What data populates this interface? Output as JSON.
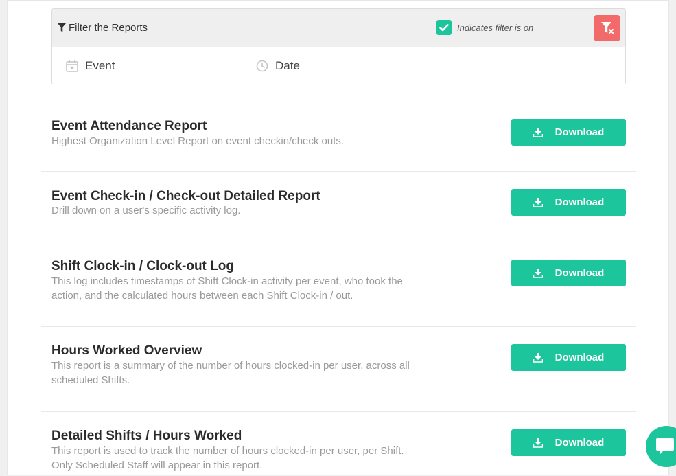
{
  "filter": {
    "title": "Filter the Reports",
    "indicator_text": "Indicates filter is on",
    "options": [
      {
        "label": "Event",
        "icon": "calendar-star-icon"
      },
      {
        "label": "Date",
        "icon": "clock-icon"
      }
    ]
  },
  "reports": [
    {
      "title": "Event Attendance Report",
      "description": "Highest Organization Level Report on event checkin/check outs.",
      "button": "Download"
    },
    {
      "title": "Event Check-in / Check-out Detailed Report",
      "description": "Drill down on a user's specific activity log.",
      "button": "Download"
    },
    {
      "title": "Shift Clock-in / Clock-out Log",
      "description": "This log includes timestamps of Shift Clock-in activity per event, who took the action, and the calculated hours between each Shift Clock-in / out.",
      "button": "Download"
    },
    {
      "title": "Hours Worked Overview",
      "description": "This report is a summary of the number of hours clocked-in per user, across all scheduled Shifts.",
      "button": "Download"
    },
    {
      "title": "Detailed Shifts / Hours Worked",
      "description": "This report is used to track the number of hours clocked-in per user, per Shift. Only Scheduled Staff will appear in this report.",
      "button": "Download"
    }
  ],
  "colors": {
    "accent": "#1cc59b",
    "danger": "#f26a6a"
  }
}
